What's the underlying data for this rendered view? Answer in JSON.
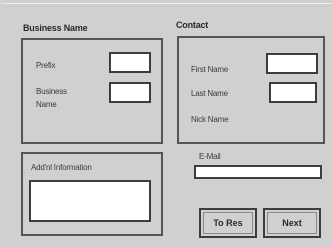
{
  "business": {
    "title": "Business Name",
    "prefix_label": "Prefix",
    "prefix_value": "",
    "business_name_label_line1": "Business",
    "business_name_label_line2": "Name",
    "business_name_value": ""
  },
  "contact": {
    "title": "Contact",
    "first_name_label": "First Name",
    "first_name_value": "",
    "last_name_label": "Last Name",
    "last_name_value": "",
    "nick_name_label": "Nick Name"
  },
  "additional": {
    "label": "Add'nl Information",
    "value": ""
  },
  "email": {
    "label": "E-Mail",
    "value": ""
  },
  "buttons": {
    "to_res": "To Res",
    "next": "Next"
  }
}
